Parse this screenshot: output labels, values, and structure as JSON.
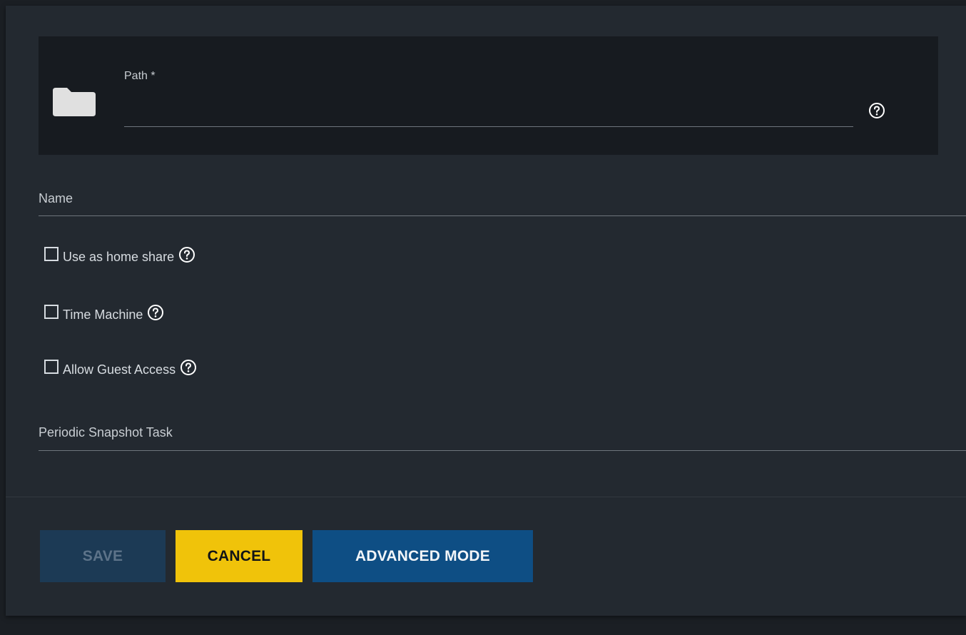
{
  "form": {
    "path": {
      "label": "Path *",
      "value": ""
    },
    "name": {
      "label": "Name",
      "value": ""
    },
    "checkboxes": [
      {
        "label": "Use as home share",
        "checked": false
      },
      {
        "label": "Time Machine",
        "checked": false
      },
      {
        "label": "Allow Guest Access",
        "checked": false
      }
    ],
    "snapshot": {
      "label": "Periodic Snapshot Task",
      "value": ""
    }
  },
  "actions": {
    "save_label": "SAVE",
    "cancel_label": "CANCEL",
    "advanced_label": "ADVANCED MODE"
  },
  "icons": {
    "folder": "folder-icon",
    "help": "help-circle-icon"
  },
  "colors": {
    "background": "#1b1f24",
    "card": "#232930",
    "path_panel": "#171b20",
    "save_button": "#1c3a55",
    "cancel_button": "#f0c30a",
    "advanced_button": "#0e4e84"
  }
}
